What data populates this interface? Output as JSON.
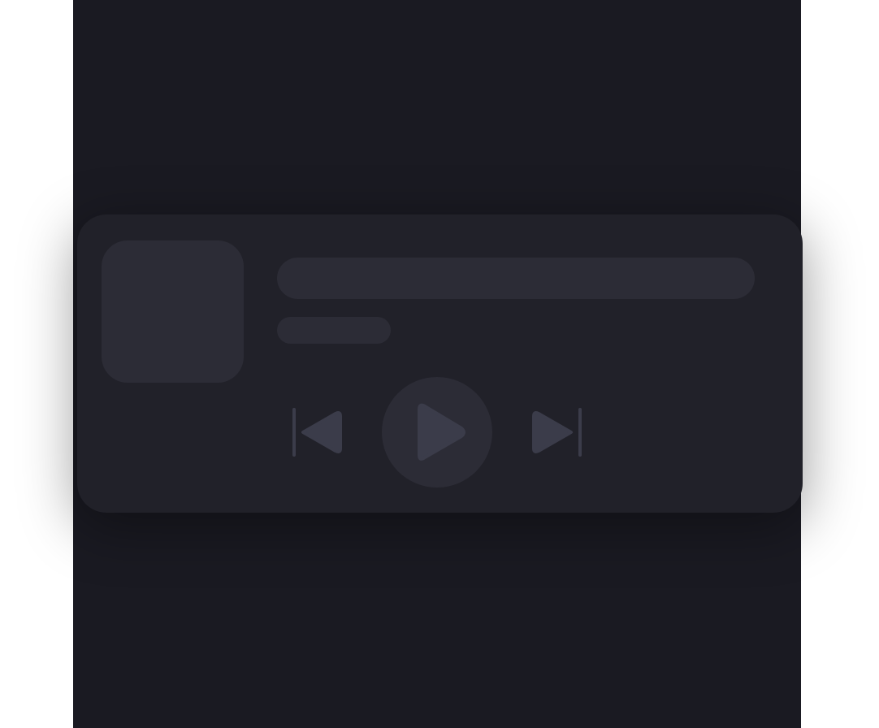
{
  "player": {
    "track_title": "",
    "artist_name": "",
    "state": "loading",
    "controls": {
      "previous_icon": "skip-previous-icon",
      "play_icon": "play-icon",
      "next_icon": "skip-next-icon"
    }
  },
  "colors": {
    "background": "#1a1a22",
    "card": "#212129",
    "skeleton": "#2c2c36",
    "icon": "#3b3c4a",
    "page": "#ffffff"
  }
}
